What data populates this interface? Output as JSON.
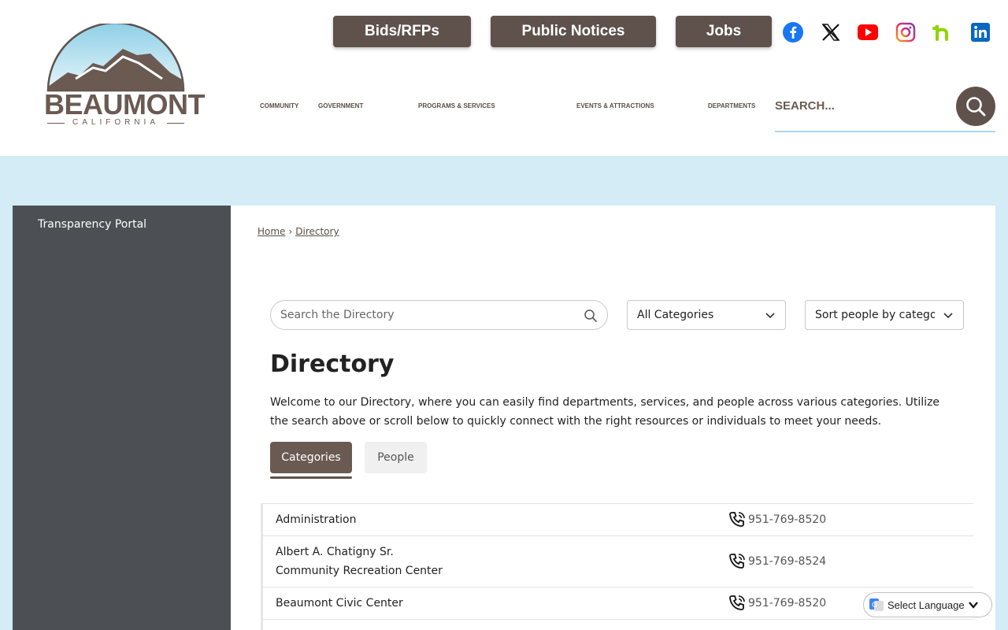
{
  "logo": {
    "name": "BEAUMONT",
    "sub": "CALIFORNIA"
  },
  "top_buttons": [
    {
      "label": "Bids/RFPs"
    },
    {
      "label": "Public Notices"
    },
    {
      "label": "Jobs"
    }
  ],
  "social": [
    "facebook-icon",
    "x-twitter-icon",
    "youtube-icon",
    "instagram-icon",
    "nextdoor-icon",
    "linkedin-icon"
  ],
  "nav": [
    {
      "label": "Community"
    },
    {
      "label": "Government"
    },
    {
      "label": "Programs & Services"
    },
    {
      "label": "Events & Attractions"
    },
    {
      "label": "Departments"
    }
  ],
  "search": {
    "placeholder": "SEARCH..."
  },
  "sidebar": {
    "items": [
      {
        "label": "Transparency Portal"
      }
    ]
  },
  "breadcrumb": {
    "home": "Home",
    "sep": "›",
    "current": "Directory"
  },
  "directory": {
    "search_placeholder": "Search the Directory",
    "category_select": "All Categories",
    "sort_select": "Sort people by category",
    "title": "Directory",
    "description": "Welcome to our Directory, where you can easily find departments, services, and people across various categories. Utilize the search above or scroll below to quickly connect with the right resources or individuals to meet your needs.",
    "tabs": [
      {
        "label": "Categories"
      },
      {
        "label": "People"
      }
    ],
    "rows": [
      {
        "name": "Administration",
        "phone": "951-769-8520"
      },
      {
        "name": "Albert A. Chatigny Sr. Community Recreation Center",
        "phone": "951-769-8524"
      },
      {
        "name": "Beaumont Civic Center",
        "phone": "951-769-8520"
      }
    ]
  },
  "language": {
    "label": "Select Language"
  },
  "colors": {
    "brand_brown": "#5f524c",
    "sidebar": "#4c5054",
    "band": "#d3ecf6",
    "underline": "#a9d8ea"
  }
}
